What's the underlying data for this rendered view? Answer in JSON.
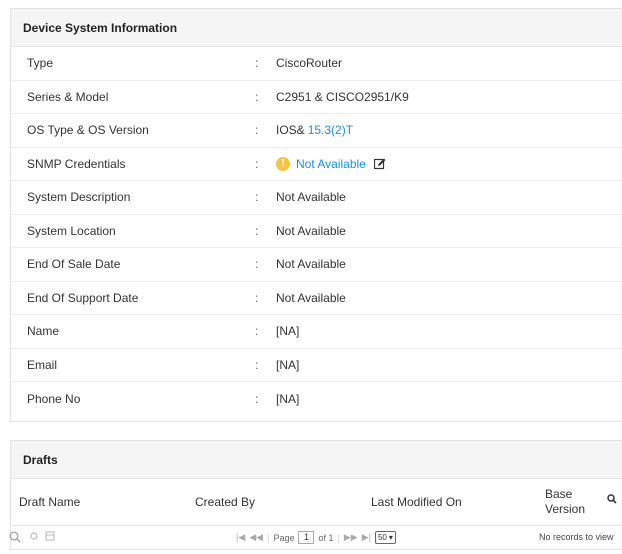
{
  "info": {
    "title": "Device System Information",
    "rows": [
      {
        "label": "Type",
        "value": "CiscoRouter"
      },
      {
        "label": "Series & Model",
        "value": "C2951 & CISCO2951/K9"
      },
      {
        "label": "OS Type & OS Version",
        "value_prefix": "IOS&",
        "value_link": "15.3(2)T"
      },
      {
        "label": "SNMP Credentials",
        "value_link": "Not Available"
      },
      {
        "label": "System Description",
        "value": "Not Available"
      },
      {
        "label": "System Location",
        "value": "Not Available"
      },
      {
        "label": "End Of Sale Date",
        "value": "Not Available"
      },
      {
        "label": "End Of Support Date",
        "value": "Not Available"
      },
      {
        "label": "Name",
        "value": "[NA]"
      },
      {
        "label": "Email",
        "value": "[NA]"
      },
      {
        "label": "Phone No",
        "value": "[NA]"
      }
    ],
    "colon": ":"
  },
  "drafts": {
    "title": "Drafts",
    "columns": [
      "Draft Name",
      "Created By",
      "Last Modified On",
      "Base Version"
    ],
    "pager": {
      "page_label": "Page",
      "page": "1",
      "of_label": "of 1",
      "page_size": "50",
      "empty_text": "No records to view"
    }
  },
  "icons": {
    "warning": "!",
    "search_glyph": "🔍"
  }
}
